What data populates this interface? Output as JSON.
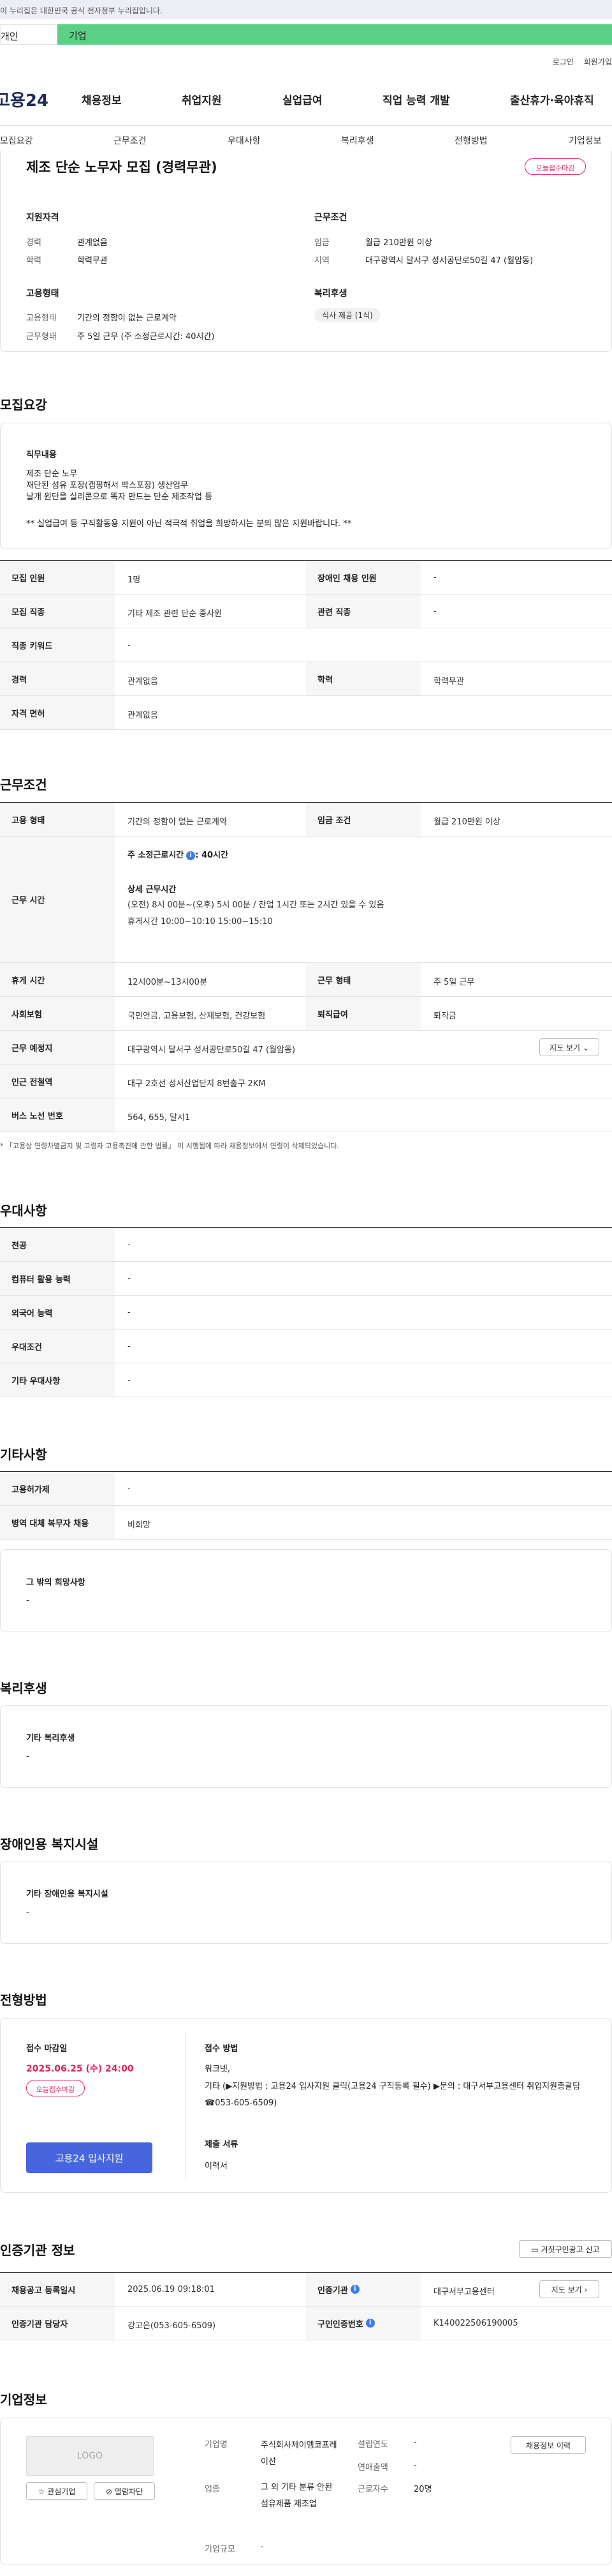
{
  "gov_banner": "이 누리집은 대한민국 공식 전자정부 누리집입니다.",
  "segments": {
    "personal": "개인",
    "company": "기업"
  },
  "util": {
    "login": "로그인",
    "join": "회원가입"
  },
  "logo": "고용24",
  "gnb": [
    "채용정보",
    "취업지원",
    "실업급여",
    "직업 능력 개발",
    "출산휴가·육아휴직"
  ],
  "subtabs": [
    "모집요강",
    "근무조건",
    "우대사항",
    "복리후생",
    "전형방법",
    "기업정보"
  ],
  "job": {
    "title": "제조 단순 노무자 모집 (경력무관)",
    "badge": "오늘접수마감",
    "qual_label": "지원자격",
    "cond_label": "근무조건",
    "career_k": "경력",
    "career_v": "관계없음",
    "edu_k": "학력",
    "edu_v": "학력무관",
    "wage_k": "임금",
    "wage_v": "월급 210만원 이상",
    "region_k": "지역",
    "region_v": "대구광역시 달서구 성서공단로50길 47 (월암동)",
    "emp_label": "고용형태",
    "emptype_k": "고용형태",
    "emptype_v": "기간의 정함이 없는 근로계약",
    "worktype_k": "근무형태",
    "worktype_v": "주 5일 근무 (주 소정근로시간: 40시간)",
    "welfare_label": "복리후생",
    "welfare_chip": "식사 제공 (1식)"
  },
  "recruit": {
    "heading": "모집요강",
    "duty_label": "직무내용",
    "duty_lines": [
      "제조 단순 노무",
      "재단된 섬유 포장(캡핑해서 박스포장) 생산업무",
      "날개 원단을 실리콘으로 똑자 만드는 단순 제조작업 등"
    ],
    "duty_note": "** 실업급여 등 구직활동용 지원이 아닌 적극적 취업을 희망하시는 분의 많은 지원바랍니다. **",
    "rows": [
      {
        "k1": "모집 인원",
        "v1": "1명",
        "k2": "장애인 채용 인원",
        "v2": "-"
      },
      {
        "k1": "모집 직종",
        "v1": "기타 제조 관련 단순 종사원",
        "k2": "관련 직종",
        "v2": "-"
      },
      {
        "k1": "직종 키워드",
        "v1": "-"
      },
      {
        "k1": "경력",
        "v1": "관계없음",
        "k2": "학력",
        "v2": "학력무관"
      },
      {
        "k1": "자격 면허",
        "v1": "관계없음"
      }
    ]
  },
  "work": {
    "heading": "근무조건",
    "emp_k": "고용 형태",
    "emp_v": "기간의 정함이 없는 근로계약",
    "wage_k": "임금 조건",
    "wage_v": "월급 210만원 이상",
    "time_k": "근무 시간",
    "weekly": "주 소정근로시간",
    "weekly_v": ": 40시간",
    "detail_label": "상세 근무시간",
    "detail_1": "(오전) 8시 00분~(오후) 5시 00분 / 잔업 1시간 또는 2시간 있을 수 있음",
    "detail_2": "휴게시간 10:00~10:10  15:00~15:10",
    "break_k": "휴게 시간",
    "break_v": "12시00분~13시00분",
    "form_k": "근무 형태",
    "form_v": "주 5일 근무",
    "ins_k": "사회보험",
    "ins_v": "국민연금, 고용보험, 산재보험, 건강보험",
    "ret_k": "퇴직급여",
    "ret_v": "퇴직금",
    "place_k": "근무 예정지",
    "place_v": "대구광역시 달서구 성서공단로50길 47 (월암동)",
    "map_btn": "지도 보기",
    "subway_k": "인근 전철역",
    "subway_v": "대구 2호선 성서산업단지 8번출구 2KM",
    "bus_k": "버스 노선 번호",
    "bus_v": "564, 655, 달서1",
    "note": "* 「고용상 연령차별금지 및 고령자 고용촉진에 관한 법률」 이 시행됨에 따라 채용정보에서 연령이 삭제되었습니다."
  },
  "pref": {
    "heading": "우대사항",
    "rows": [
      {
        "k": "전공",
        "v": "-"
      },
      {
        "k": "컴퓨터 활용 능력",
        "v": "-"
      },
      {
        "k": "외국어 능력",
        "v": "-"
      },
      {
        "k": "우대조건",
        "v": "-"
      },
      {
        "k": "기타 우대사항",
        "v": "-"
      }
    ]
  },
  "etc": {
    "heading": "기타사항",
    "rows": [
      {
        "k": "고용허가제",
        "v": "-"
      },
      {
        "k": "병역 대체 복무자 채용",
        "v": "비희망"
      }
    ],
    "other_label": "그 밖의 희망사항",
    "other_v": "-"
  },
  "benefit": {
    "heading": "복리후생",
    "label": "기타 복리후생",
    "v": "-"
  },
  "disab": {
    "heading": "장애인용 복지시설",
    "label": "기타 장애인용 복지시설",
    "v": "-"
  },
  "select": {
    "heading": "전형방법",
    "deadline_label": "접수 마감일",
    "deadline": "2025.06.25 (수) 24:00",
    "badge": "오늘접수마감",
    "apply_btn": "고용24 입사지원",
    "method_label": "접수 방법",
    "method_1": "워크넷,",
    "method_2": "기타 (▶지원방법 : 고용24 입사지원 클릭(고용24 구직등록 필수) ▶문의 : 대구서부고용센터 취업지원총괄팀 ☎053-605-6509)",
    "docs_label": "제출 서류",
    "docs_v": "이력서"
  },
  "cert": {
    "heading": "인증기관 정보",
    "report_btn": "거짓구인광고 신고",
    "reg_k": "채용공고 등록일시",
    "reg_v": "2025.06.19 09:18:01",
    "org_k": "인증기관",
    "org_v": "대구서부고용센터",
    "map_btn": "지도 보기",
    "staff_k": "인증기관 담당자",
    "staff_v": "강고은(053-605-6509)",
    "no_k": "구인인증번호",
    "no_v": "K140022506190005"
  },
  "company": {
    "heading": "기업정보",
    "logo": "LOGO",
    "fav_btn": "관심기업",
    "hide_btn": "열람차단",
    "name_k": "기업명",
    "name_v": "주식회사제이엠코프레이션",
    "ind_k": "업종",
    "ind_v": "그 외 기타 분류 안된 섬유제품 제조업",
    "size_k": "기업규모",
    "size_v": "-",
    "year_k": "설립연도",
    "year_v": "-",
    "sales_k": "연매출액",
    "sales_v": "-",
    "emp_k": "근로자수",
    "emp_v": "20명",
    "jobs_btn": "채용정보 이력"
  }
}
